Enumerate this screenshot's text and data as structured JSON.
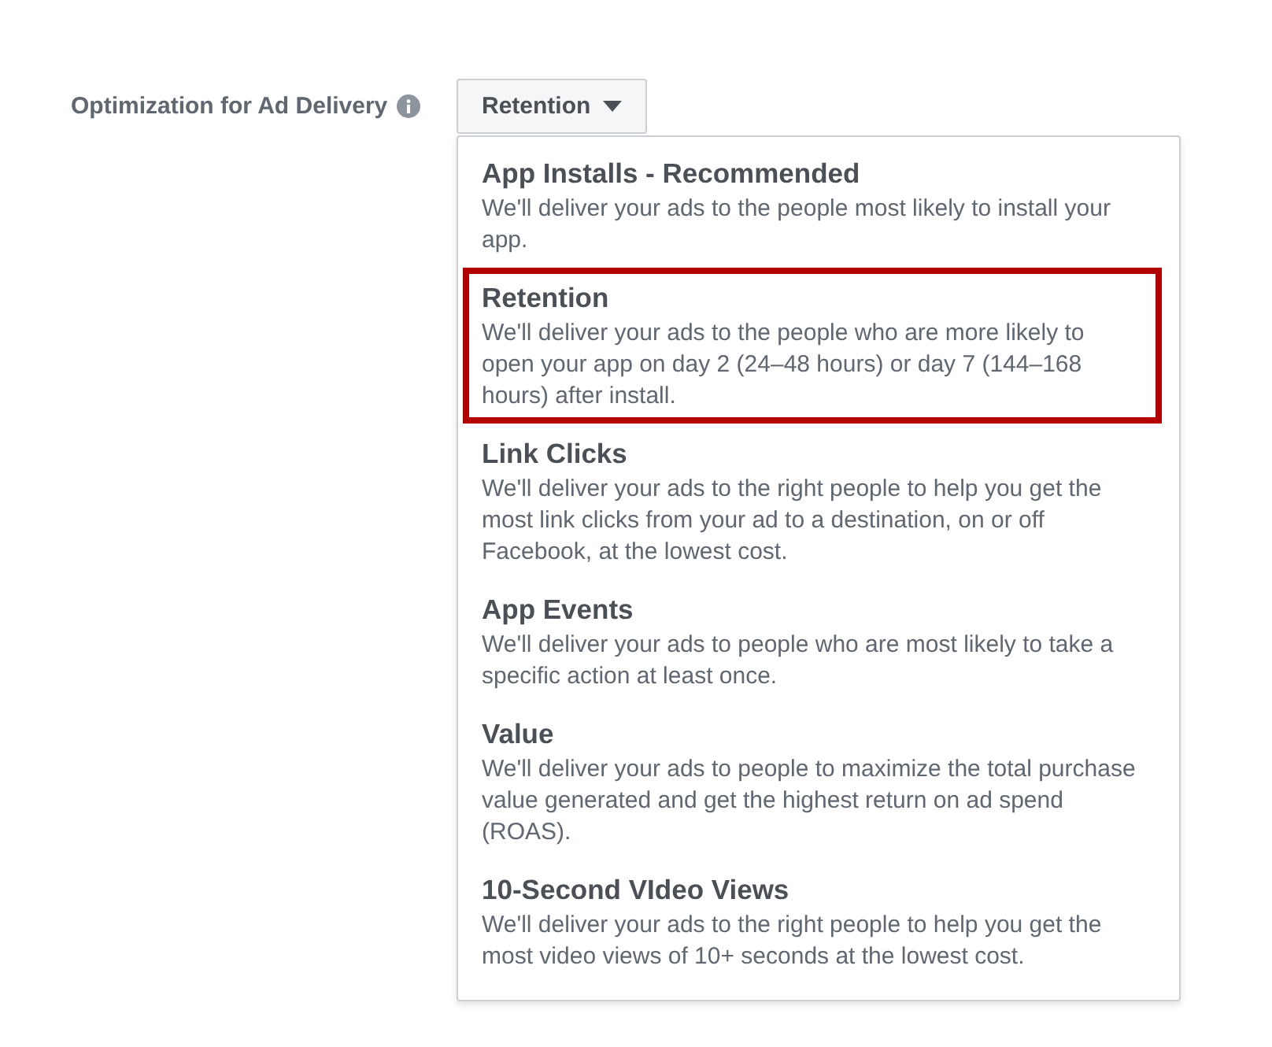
{
  "field": {
    "label": "Optimization for Ad Delivery"
  },
  "dropdown": {
    "value": "Retention",
    "expanded": true,
    "options": [
      {
        "title": "App Installs - Recommended",
        "description": "We'll deliver your ads to the people most likely to install your app.",
        "highlighted": false
      },
      {
        "title": "Retention",
        "description": "We'll deliver your ads to the people who are more likely to open your app on day 2 (24–48 hours) or day 7 (144–168 hours) after install.",
        "highlighted": true
      },
      {
        "title": "Link Clicks",
        "description": "We'll deliver your ads to the right people to help you get the most link clicks from your ad to a destination, on or off Facebook, at the lowest cost.",
        "highlighted": false
      },
      {
        "title": "App Events",
        "description": "We'll deliver your ads to people who are most likely to take a specific action at least once.",
        "highlighted": false
      },
      {
        "title": "Value",
        "description": "We'll deliver your ads to people to maximize the total purchase value generated and get the highest return on ad spend (ROAS).",
        "highlighted": false
      },
      {
        "title": "10-Second VIdeo Views",
        "description": "We'll deliver your ads to the right people to help you get the most video views of 10+ seconds at the lowest cost.",
        "highlighted": false
      }
    ]
  }
}
